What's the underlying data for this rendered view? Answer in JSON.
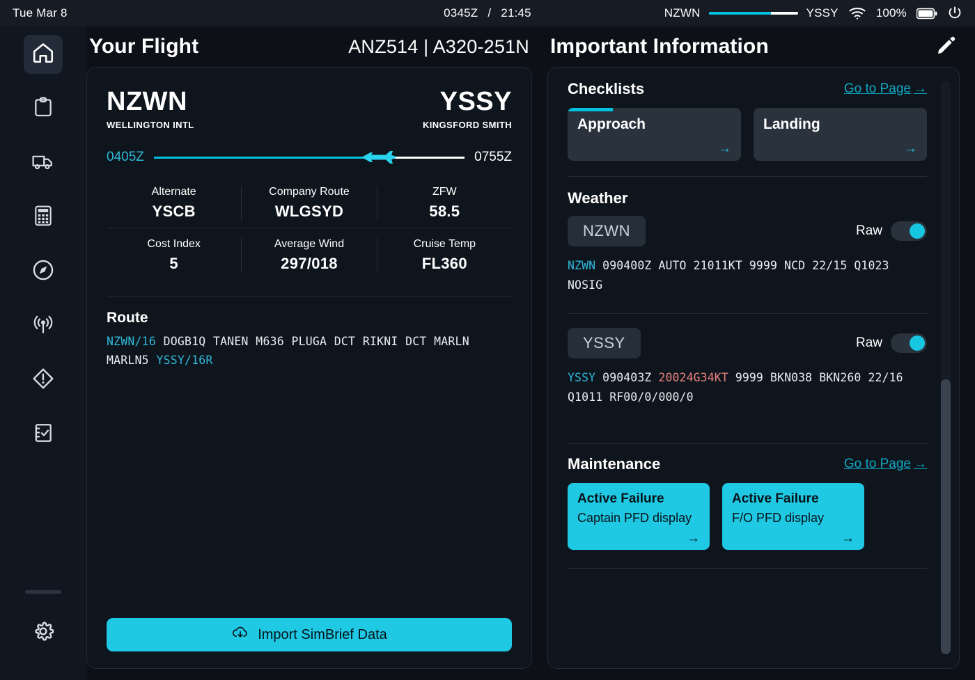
{
  "statusbar": {
    "date": "Tue Mar 8",
    "zulu_time": "0345Z",
    "separator": "/",
    "local_time": "21:45",
    "origin": "NZWN",
    "destination": "YSSY",
    "progress_percent": 70,
    "battery_percent": "100%",
    "icons": {
      "wifi": "wifi-icon",
      "battery": "battery-icon",
      "power": "power-icon"
    }
  },
  "sidebar": {
    "items": [
      {
        "name": "home",
        "icon": "home-icon",
        "active": true
      },
      {
        "name": "dispatch",
        "icon": "clipboard-icon",
        "active": false
      },
      {
        "name": "ground-services",
        "icon": "truck-icon",
        "active": false
      },
      {
        "name": "performance",
        "icon": "calculator-icon",
        "active": false
      },
      {
        "name": "navigation",
        "icon": "compass-icon",
        "active": false
      },
      {
        "name": "atc",
        "icon": "broadcast-icon",
        "active": false
      },
      {
        "name": "failures",
        "icon": "warning-diamond-icon",
        "active": false
      },
      {
        "name": "checklists",
        "icon": "checklist-icon",
        "active": false
      }
    ],
    "settings": {
      "name": "settings",
      "icon": "gear-icon"
    }
  },
  "left": {
    "title": "Your Flight",
    "flight_id": "ANZ514 | A320-251N",
    "origin": {
      "code": "NZWN",
      "name": "WELLINGTON INTL"
    },
    "destination": {
      "code": "YSSY",
      "name": "KINGSFORD SMITH"
    },
    "departure_time": "0405Z",
    "arrival_time": "0755Z",
    "progress_percent": 72,
    "stats": [
      [
        {
          "label": "Alternate",
          "value": "YSCB"
        },
        {
          "label": "Company Route",
          "value": "WLGSYD"
        },
        {
          "label": "ZFW",
          "value": "58.5"
        }
      ],
      [
        {
          "label": "Cost Index",
          "value": "5"
        },
        {
          "label": "Average Wind",
          "value": "297/018"
        },
        {
          "label": "Cruise Temp",
          "value": "FL360"
        }
      ]
    ],
    "route": {
      "title": "Route",
      "origin_token": "NZWN/16",
      "body": " DOGB1Q TANEN M636 PLUGA DCT RIKNI DCT MARLN MARLN5 ",
      "destination_token": "YSSY/16R"
    },
    "import_button": "Import SimBrief Data",
    "import_icon": "cloud-download-icon"
  },
  "right": {
    "title": "Important Information",
    "edit_icon": "pencil-icon",
    "checklists": {
      "title": "Checklists",
      "goto_label": "Go to Page",
      "items": [
        {
          "name": "Approach",
          "progress_percent": 26
        },
        {
          "name": "Landing",
          "progress_percent": 0
        }
      ]
    },
    "weather": {
      "title": "Weather",
      "stations": [
        {
          "icao": "NZWN",
          "raw_label": "Raw",
          "raw_enabled": true,
          "metar_station": "NZWN",
          "metar_body": " 090400Z AUTO 21011KT 9999 NCD 22/15 Q1023 NOSIG"
        },
        {
          "icao": "YSSY",
          "raw_label": "Raw",
          "raw_enabled": true,
          "metar_station": "YSSY",
          "metar_pre": " 090403Z ",
          "metar_warning": "20024G34KT",
          "metar_post": " 9999 BKN038 BKN260 22/16 Q1011 RF00/0/000/0"
        }
      ]
    },
    "maintenance": {
      "title": "Maintenance",
      "goto_label": "Go to Page",
      "items": [
        {
          "title": "Active Failure",
          "description": "Captain PFD display"
        },
        {
          "title": "Active Failure",
          "description": "F/O PFD display"
        }
      ]
    }
  },
  "colors": {
    "accent": "#1fc8e3",
    "accent_dark": "#0fa8c4",
    "warning": "#e8807e",
    "background": "#0d1117"
  }
}
